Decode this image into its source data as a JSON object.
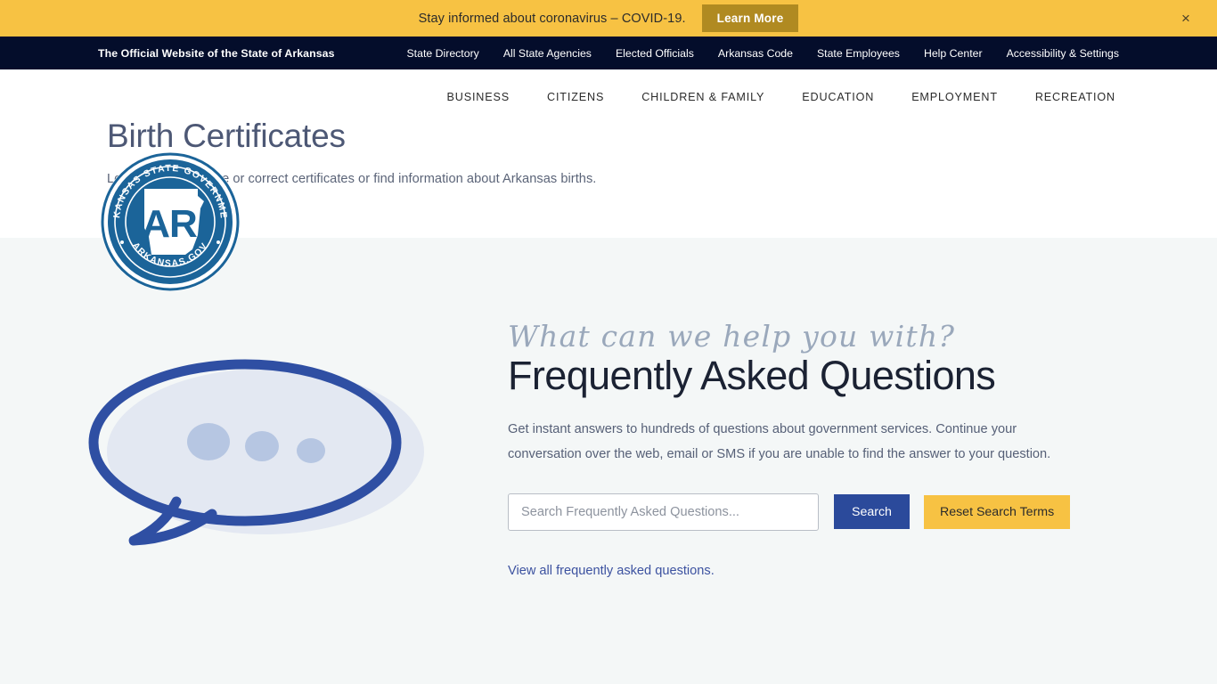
{
  "alert": {
    "message": "Stay informed about coronavirus – COVID-19.",
    "button_label": "Learn More",
    "close_icon": "close-icon",
    "close_glyph": "×",
    "background_color": "#f7c243",
    "button_color": "#b08a21"
  },
  "state_bar": {
    "brand": "The Official Website of the State of Arkansas",
    "background_color": "#040d2b",
    "links": [
      "State Directory",
      "All State Agencies",
      "Elected Officials",
      "Arkansas Code",
      "State Employees",
      "Help Center",
      "Accessibility & Settings"
    ]
  },
  "logo": {
    "name": "arkansas-state-government-seal",
    "top_text": "ARKANSAS STATE GOVERNMENT",
    "bottom_text": "ARKANSAS.GOV",
    "monogram": "AR",
    "color": "#1b6499"
  },
  "main_nav": {
    "items": [
      "BUSINESS",
      "CITIZENS",
      "CHILDREN & FAMILY",
      "EDUCATION",
      "EMPLOYMENT",
      "RECREATION"
    ]
  },
  "hero": {
    "title": "Birth Certificates",
    "subtitle": "Learn how to change or correct certificates or find information about Arkansas births."
  },
  "faq": {
    "eyebrow": "What can we help you with?",
    "heading": "Frequently Asked Questions",
    "body": "Get instant answers to hundreds of questions about government services. Continue your conversation over the web, email or SMS if you are unable to find the answer to your question.",
    "search_placeholder": "Search Frequently Asked Questions...",
    "search_value": "",
    "search_button": "Search",
    "reset_button": "Reset Search Terms",
    "view_all_link": "View all frequently asked questions.",
    "illustration": "speech-bubble-illustration",
    "background_color": "#f4f7f7",
    "accent_blue": "#2b4a9b",
    "accent_yellow": "#f7c243"
  }
}
